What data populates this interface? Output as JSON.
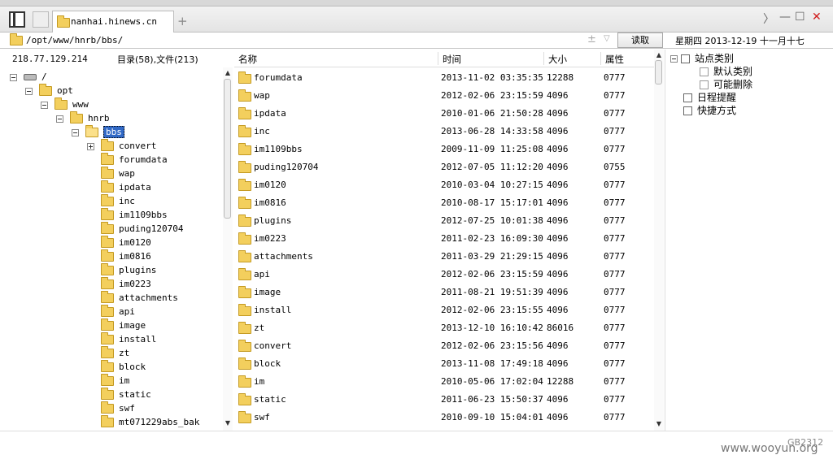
{
  "titlebar": {
    "tab_label": "nanhai.hinews.cn",
    "new_tab": "+",
    "controls": {
      "chevron": "〉",
      "minimize": "—",
      "maximize": "☐",
      "close": "✕"
    }
  },
  "pathbar": {
    "path": "/opt/www/hnrb/bbs/",
    "plus_minus": "±",
    "dropdown": "▽",
    "read_button": "读取",
    "date": "星期四 2013-12-19 十一月十七"
  },
  "status": {
    "ip": "218.77.129.214",
    "counts": "目录(58),文件(213)"
  },
  "tree": {
    "items": [
      {
        "label": "/",
        "depth": 0,
        "expander": "minus",
        "icon": "drive-icon"
      },
      {
        "label": "opt",
        "depth": 1,
        "expander": "minus",
        "icon": "folder-icon"
      },
      {
        "label": "www",
        "depth": 2,
        "expander": "minus",
        "icon": "folder-icon"
      },
      {
        "label": "hnrb",
        "depth": 3,
        "expander": "minus",
        "icon": "folder-icon"
      },
      {
        "label": "bbs",
        "depth": 4,
        "expander": "minus",
        "icon": "folder-open-icon",
        "selected": true
      },
      {
        "label": "convert",
        "depth": 5,
        "expander": "plus",
        "icon": "folder-icon"
      },
      {
        "label": "forumdata",
        "depth": 5,
        "icon": "folder-icon"
      },
      {
        "label": "wap",
        "depth": 5,
        "icon": "folder-icon"
      },
      {
        "label": "ipdata",
        "depth": 5,
        "icon": "folder-icon"
      },
      {
        "label": "inc",
        "depth": 5,
        "icon": "folder-icon"
      },
      {
        "label": "im1109bbs",
        "depth": 5,
        "icon": "folder-icon"
      },
      {
        "label": "puding120704",
        "depth": 5,
        "icon": "folder-icon"
      },
      {
        "label": "im0120",
        "depth": 5,
        "icon": "folder-icon"
      },
      {
        "label": "im0816",
        "depth": 5,
        "icon": "folder-icon"
      },
      {
        "label": "plugins",
        "depth": 5,
        "icon": "folder-icon"
      },
      {
        "label": "im0223",
        "depth": 5,
        "icon": "folder-icon"
      },
      {
        "label": "attachments",
        "depth": 5,
        "icon": "folder-icon"
      },
      {
        "label": "api",
        "depth": 5,
        "icon": "folder-icon"
      },
      {
        "label": "image",
        "depth": 5,
        "icon": "folder-icon"
      },
      {
        "label": "install",
        "depth": 5,
        "icon": "folder-icon"
      },
      {
        "label": "zt",
        "depth": 5,
        "icon": "folder-icon"
      },
      {
        "label": "block",
        "depth": 5,
        "icon": "folder-icon"
      },
      {
        "label": "im",
        "depth": 5,
        "icon": "folder-icon"
      },
      {
        "label": "static",
        "depth": 5,
        "icon": "folder-icon"
      },
      {
        "label": "swf",
        "depth": 5,
        "icon": "folder-icon"
      },
      {
        "label": "mt071229abs_bak",
        "depth": 5,
        "icon": "folder-icon"
      }
    ]
  },
  "list": {
    "columns": [
      "名称",
      "时间",
      "大小",
      "属性"
    ],
    "rows": [
      {
        "name": "forumdata",
        "time": "2013-11-02 03:35:35",
        "size": "12288",
        "attr": "0777"
      },
      {
        "name": "wap",
        "time": "2012-02-06 23:15:59",
        "size": "4096",
        "attr": "0777"
      },
      {
        "name": "ipdata",
        "time": "2010-01-06 21:50:28",
        "size": "4096",
        "attr": "0777"
      },
      {
        "name": "inc",
        "time": "2013-06-28 14:33:58",
        "size": "4096",
        "attr": "0777"
      },
      {
        "name": "im1109bbs",
        "time": "2009-11-09 11:25:08",
        "size": "4096",
        "attr": "0777"
      },
      {
        "name": "puding120704",
        "time": "2012-07-05 11:12:20",
        "size": "4096",
        "attr": "0755"
      },
      {
        "name": "im0120",
        "time": "2010-03-04 10:27:15",
        "size": "4096",
        "attr": "0777"
      },
      {
        "name": "im0816",
        "time": "2010-08-17 15:17:01",
        "size": "4096",
        "attr": "0777"
      },
      {
        "name": "plugins",
        "time": "2012-07-25 10:01:38",
        "size": "4096",
        "attr": "0777"
      },
      {
        "name": "im0223",
        "time": "2011-02-23 16:09:30",
        "size": "4096",
        "attr": "0777"
      },
      {
        "name": "attachments",
        "time": "2011-03-29 21:29:15",
        "size": "4096",
        "attr": "0777"
      },
      {
        "name": "api",
        "time": "2012-02-06 23:15:59",
        "size": "4096",
        "attr": "0777"
      },
      {
        "name": "image",
        "time": "2011-08-21 19:51:39",
        "size": "4096",
        "attr": "0777"
      },
      {
        "name": "install",
        "time": "2012-02-06 23:15:55",
        "size": "4096",
        "attr": "0777"
      },
      {
        "name": "zt",
        "time": "2013-12-10 16:10:42",
        "size": "86016",
        "attr": "0777"
      },
      {
        "name": "convert",
        "time": "2012-02-06 23:15:56",
        "size": "4096",
        "attr": "0777"
      },
      {
        "name": "block",
        "time": "2013-11-08 17:49:18",
        "size": "4096",
        "attr": "0777"
      },
      {
        "name": "im",
        "time": "2010-05-06 17:02:04",
        "size": "12288",
        "attr": "0777"
      },
      {
        "name": "static",
        "time": "2011-06-23 15:50:37",
        "size": "4096",
        "attr": "0777"
      },
      {
        "name": "swf",
        "time": "2010-09-10 15:04:01",
        "size": "4096",
        "attr": "0777"
      }
    ]
  },
  "right_panel": {
    "site_category": "站点类别",
    "default_category": "默认类别",
    "may_delete": "可能删除",
    "schedule": "日程提醒",
    "shortcuts": "快捷方式"
  },
  "footer": {
    "encoding": "GB2312",
    "watermark": "www.wooyun.org"
  }
}
